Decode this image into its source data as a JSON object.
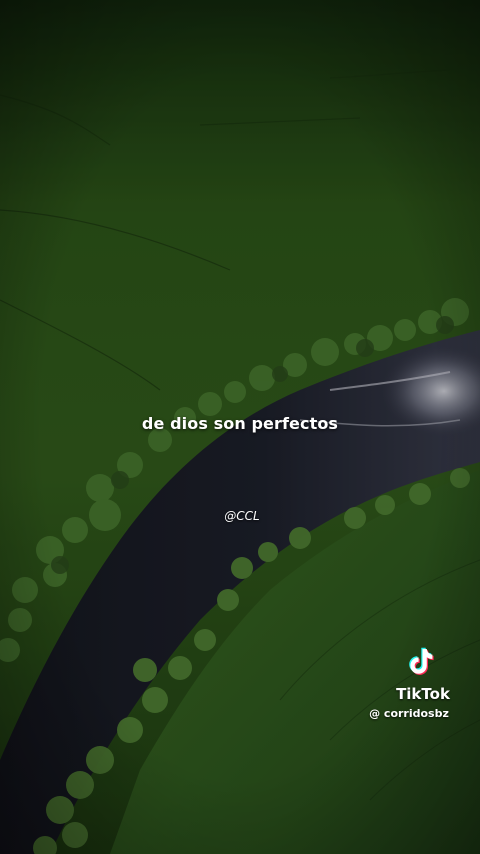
{
  "video": {
    "caption": "de dios son perfectos",
    "creator_tag": "@CCL"
  },
  "watermark": {
    "brand": "TikTok",
    "icon": "tiktok-logo-icon",
    "username": "@ corridosbz"
  },
  "colors": {
    "field_bright": "#3f6d25",
    "field_mid": "#2c521a",
    "field_dark": "#1a3410",
    "river": "#1c1f2a",
    "river_highlight": "#c9cbd6",
    "tree": "#4a7a30",
    "tiktok_cyan": "#25f4ee",
    "tiktok_red": "#fe2c55"
  }
}
